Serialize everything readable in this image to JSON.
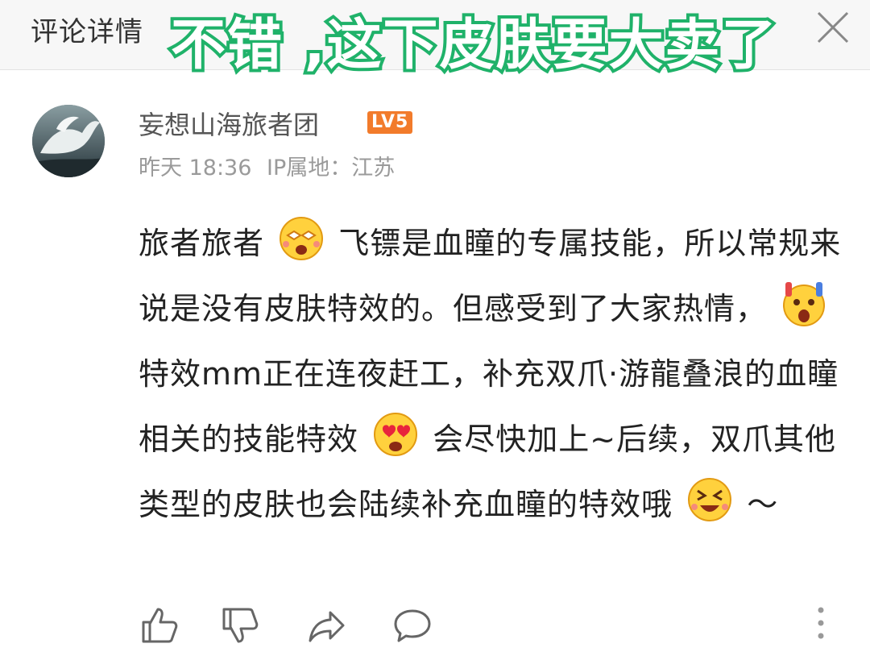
{
  "header": {
    "title": "评论详情",
    "overlay_caption": "不错 ,这下皮肤要大卖了",
    "close_icon": "close-icon"
  },
  "comment": {
    "username": "妄想山海旅者团",
    "level": "LV5",
    "date": "昨天 18:36",
    "ip_location": "IP属地：江苏",
    "segments": [
      "旅者旅者",
      "飞镖是血瞳的专属技能，所以常规来说是没有皮肤特效的。但感受到了大家热情，",
      "特效mm正在连夜赶工，补充双爪·游龍叠浪的血瞳相关的技能特效",
      "会尽快加上~后续，双爪其他类型的皮肤也会陆续补充血瞳的特效哦",
      "～"
    ],
    "emojis": [
      "starry-eyes-emoji",
      "screaming-emoji",
      "heart-eyes-emoji",
      "laughing-emoji"
    ]
  },
  "actions": {
    "icons": [
      "thumbs-up-icon",
      "thumbs-down-icon",
      "share-icon",
      "comment-icon",
      "more-vertical-icon"
    ]
  },
  "colors": {
    "caption_stroke": "#20b26a",
    "level_badge": "#f27b2b",
    "meta_text": "#9a9a9a",
    "header_bg": "#f7f7f7"
  }
}
